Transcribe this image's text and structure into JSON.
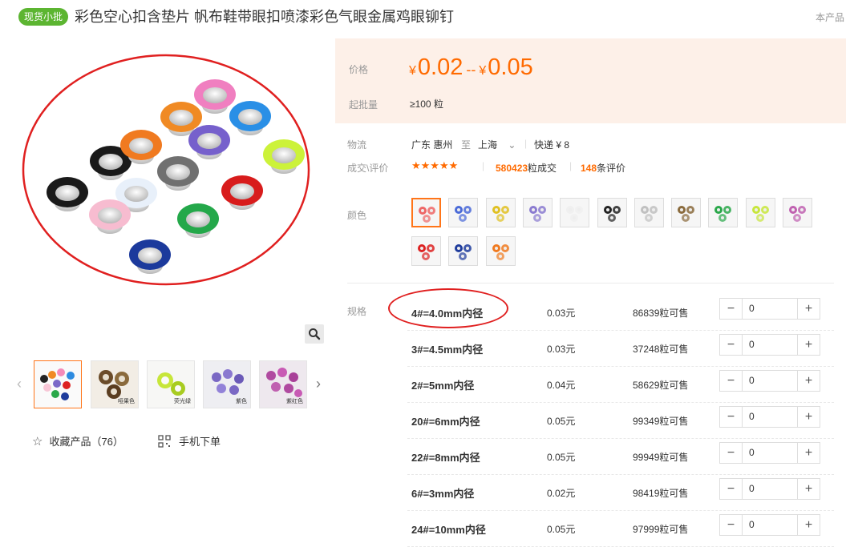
{
  "header": {
    "badge": "现货小批",
    "title": "彩色空心扣含垫片 帆布鞋带眼扣喷漆彩色气眼金属鸡眼铆钉",
    "right_text": "本产品"
  },
  "gallery": {
    "thumbs": [
      {
        "label": ""
      },
      {
        "label": "哑果色"
      },
      {
        "label": "荧光绿"
      },
      {
        "label": "紫色"
      },
      {
        "label": "紫红色"
      }
    ]
  },
  "actions": {
    "favorite": "收藏产品（76）",
    "mobile": "手机下单"
  },
  "price": {
    "label": "价格",
    "currency": "¥",
    "min": "0.02",
    "separator": "--",
    "max": "0.05",
    "moq_label": "起批量",
    "moq_value": "≥100 粒"
  },
  "logistics": {
    "label": "物流",
    "from": "广东 惠州",
    "to_word": "至",
    "to": "上海",
    "express": "快递 ¥ 8"
  },
  "deal": {
    "label": "成交\\评价",
    "stars": "★★★★★",
    "rating": 5,
    "sold_count": "580423",
    "sold_suffix": "粒成交",
    "review_count": "148",
    "review_suffix": "条评价"
  },
  "color": {
    "label": "颜色",
    "swatches": [
      {
        "name": "混色"
      },
      {
        "name": "蓝色"
      },
      {
        "name": "黄色"
      },
      {
        "name": "紫色"
      },
      {
        "name": "白色"
      },
      {
        "name": "黑色"
      },
      {
        "name": "银色"
      },
      {
        "name": "哑果色"
      },
      {
        "name": "绿色"
      },
      {
        "name": "荧光绿"
      },
      {
        "name": "紫红色"
      },
      {
        "name": "红色"
      },
      {
        "name": "深蓝色"
      },
      {
        "name": "橙色"
      }
    ]
  },
  "spec": {
    "label": "规格",
    "rows": [
      {
        "name": "4#=4.0mm内径",
        "price": "0.03元",
        "stock": "86839",
        "stock_suffix": "粒可售",
        "qty": "0"
      },
      {
        "name": "3#=4.5mm内径",
        "price": "0.03元",
        "stock": "37248",
        "stock_suffix": "粒可售",
        "qty": "0"
      },
      {
        "name": "2#=5mm内径",
        "price": "0.04元",
        "stock": "58629",
        "stock_suffix": "粒可售",
        "qty": "0"
      },
      {
        "name": "20#=6mm内径",
        "price": "0.05元",
        "stock": "99349",
        "stock_suffix": "粒可售",
        "qty": "0"
      },
      {
        "name": "22#=8mm内径",
        "price": "0.05元",
        "stock": "99949",
        "stock_suffix": "粒可售",
        "qty": "0"
      },
      {
        "name": "6#=3mm内径",
        "price": "0.02元",
        "stock": "98419",
        "stock_suffix": "粒可售",
        "qty": "0"
      },
      {
        "name": "24#=10mm内径",
        "price": "0.05元",
        "stock": "97999",
        "stock_suffix": "粒可售",
        "qty": "0"
      }
    ]
  },
  "colors": {
    "accent": "#ff6a00",
    "badge": "#5cb531",
    "price_bg": "#fdf0e8",
    "annotation": "#e02020"
  }
}
